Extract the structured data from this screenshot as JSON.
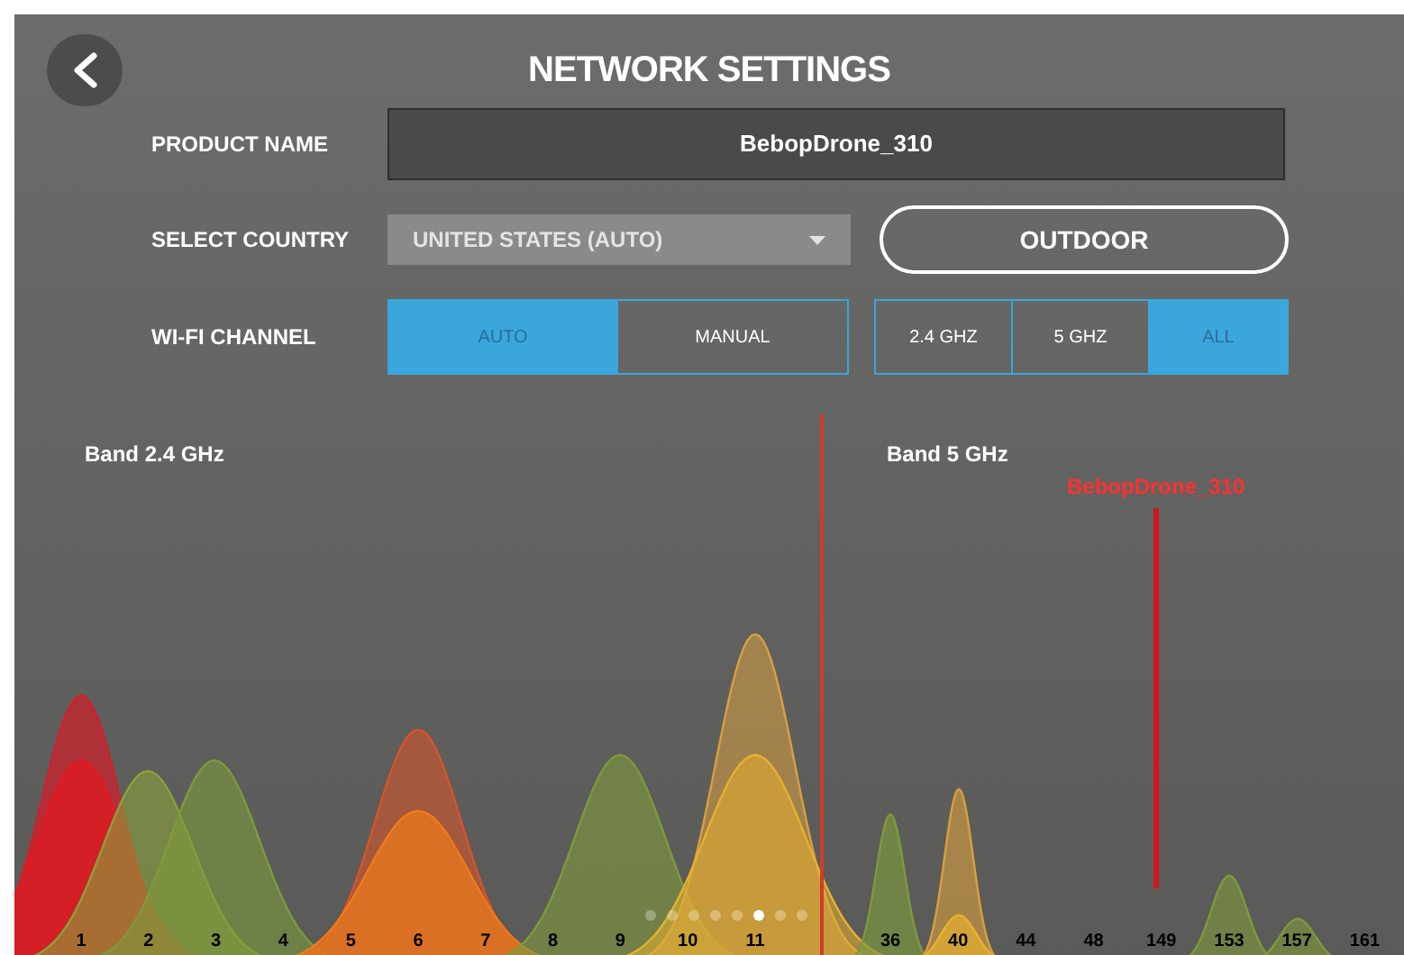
{
  "title": "NETWORK SETTINGS",
  "product_name": {
    "label": "PRODUCT NAME",
    "value": "BebopDrone_310"
  },
  "country": {
    "label": "SELECT COUNTRY",
    "value": "UNITED STATES (AUTO)",
    "disabled": true
  },
  "outdoor_button": "OUTDOOR",
  "wifi_channel": {
    "label": "WI-FI CHANNEL",
    "mode": [
      {
        "label": "AUTO",
        "selected": true
      },
      {
        "label": "MANUAL",
        "selected": false
      }
    ],
    "band": [
      {
        "label": "2.4 GHZ",
        "selected": false
      },
      {
        "label": "5 GHZ",
        "selected": false
      },
      {
        "label": "ALL",
        "selected": true
      }
    ]
  },
  "chart": {
    "bands": [
      "Band 2.4 GHz",
      "Band 5 GHz"
    ],
    "network_marker": "BebopDrone_310",
    "channels": [
      "1",
      "2",
      "3",
      "4",
      "5",
      "6",
      "7",
      "8",
      "9",
      "10",
      "11",
      "36",
      "40",
      "44",
      "48",
      "149",
      "153",
      "157",
      "161"
    ]
  },
  "pager": [
    {
      "selected": false
    },
    {
      "selected": false
    },
    {
      "selected": false
    },
    {
      "selected": false
    },
    {
      "selected": false
    },
    {
      "selected": true
    },
    {
      "selected": false
    },
    {
      "selected": false
    }
  ]
}
